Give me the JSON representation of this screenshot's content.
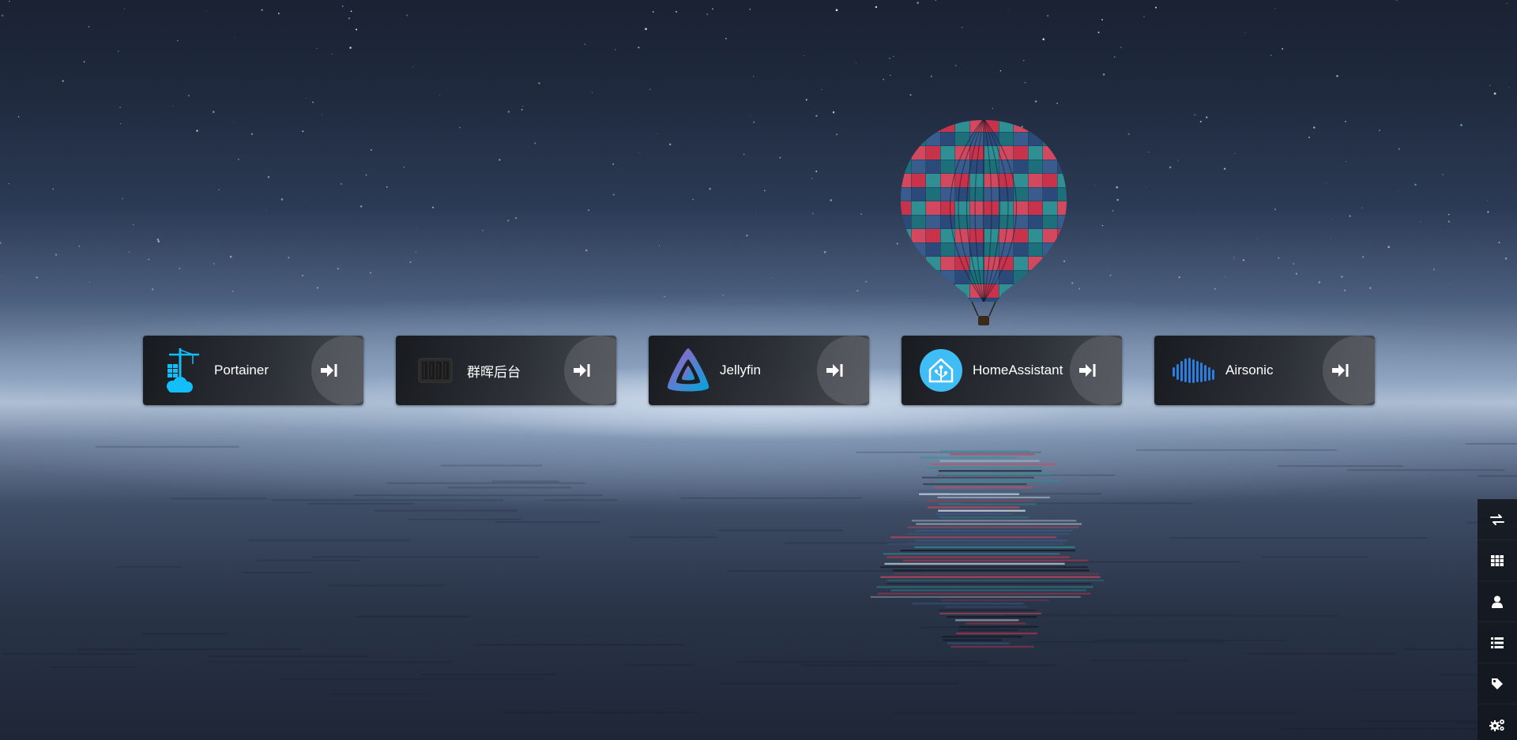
{
  "apps": [
    {
      "name": "Portainer",
      "icon": "portainer-icon"
    },
    {
      "name": "群晖后台",
      "icon": "synology-nas-icon"
    },
    {
      "name": "Jellyfin",
      "icon": "jellyfin-icon"
    },
    {
      "name": "HomeAssistant",
      "icon": "home-assistant-icon"
    },
    {
      "name": "Airsonic",
      "icon": "airsonic-icon"
    }
  ],
  "card_action_icon": "sign-in-arrow-icon",
  "sidebar": {
    "items": [
      "exchange-icon",
      "grid-icon",
      "user-icon",
      "list-icon",
      "tag-icon",
      "cogs-icon"
    ]
  },
  "colors": {
    "card_text": "#ffffff",
    "portainer": "#13bef9",
    "jellyfin_purple": "#aa5cc3",
    "jellyfin_blue": "#00a4dc",
    "home_assistant": "#41bdf5",
    "airsonic": "#2a7de1"
  }
}
